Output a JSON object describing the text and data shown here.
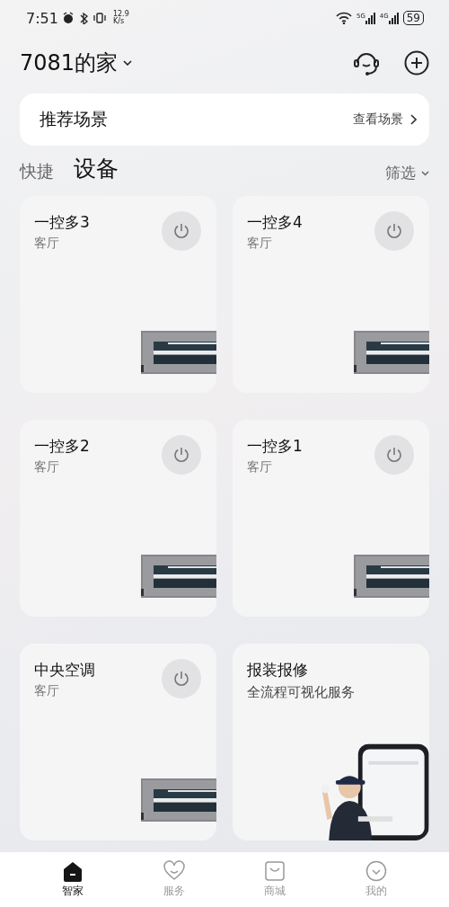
{
  "status_bar": {
    "time": "7:51",
    "speed_value": "12.9",
    "speed_unit": "K/s",
    "signals": [
      {
        "label": "5G"
      },
      {
        "label": "4G"
      }
    ],
    "battery": "59"
  },
  "header": {
    "home_name": "7081的家"
  },
  "scene_card": {
    "title": "推荐场景",
    "link": "查看场景"
  },
  "tabs": [
    {
      "label": "快捷",
      "selected": false
    },
    {
      "label": "设备",
      "selected": true
    }
  ],
  "filter": "筛选",
  "cards": [
    {
      "kind": "device",
      "name": "一控多3",
      "room": "客厅"
    },
    {
      "kind": "device",
      "name": "一控多4",
      "room": "客厅"
    },
    {
      "kind": "device",
      "name": "一控多2",
      "room": "客厅"
    },
    {
      "kind": "device",
      "name": "一控多1",
      "room": "客厅"
    },
    {
      "kind": "device",
      "name": "中央空调",
      "room": "客厅"
    },
    {
      "kind": "service",
      "title": "报装报修",
      "subtitle": "全流程可视化服务"
    }
  ],
  "nav": [
    {
      "label": "智家",
      "selected": true
    },
    {
      "label": "服务",
      "selected": false
    },
    {
      "label": "商城",
      "selected": false
    },
    {
      "label": "我的",
      "selected": false
    }
  ]
}
